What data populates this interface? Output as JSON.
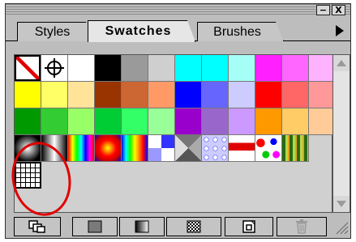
{
  "window": {
    "minimize_label": "−",
    "close_label": "X"
  },
  "tabs": [
    {
      "label": "Styles"
    },
    {
      "label": "Swatches"
    },
    {
      "label": "Brushes"
    }
  ],
  "active_tab": "Swatches",
  "icons": {
    "panel_menu": "triangle-right-icon",
    "scroll_up": "scroll-up-arrow-icon",
    "scroll_down": "scroll-down-arrow-icon",
    "resize": "resize-grip-icon"
  },
  "swatches": {
    "row1": [
      "none",
      "registration",
      "#ffffff",
      "#000000",
      "#9a9a9a",
      "#cfcfcf",
      "#00ffff",
      "#00ffff",
      "#a6fff7",
      "#ff1fff",
      "#ff66ff",
      "#ffb3ff"
    ],
    "row2": [
      "#ffff00",
      "#ffff66",
      "#ffe399",
      "#993300",
      "#cc6633",
      "#ff9966",
      "#0000ff",
      "#6666ff",
      "#ccccff",
      "#ff0000",
      "#ff6666",
      "#ff9999"
    ],
    "row3": [
      "#009900",
      "#33cc33",
      "#99ff66",
      "#00cc33",
      "#33ff66",
      "#99ff99",
      "#9900cc",
      "#9966cc",
      "#cc99ff",
      "#ff9900",
      "#ffcc66",
      "#ffcc99"
    ],
    "row4": [
      "gradient-radial-black",
      "gradient-linear-gray",
      "gradient-rainbow",
      "gradient-radial-red",
      "gradient-spectrum",
      "pattern-blue-tiles",
      "pattern-gray-pyramid",
      "pattern-blue-circles",
      "pattern-red-stripes",
      "pattern-confetti",
      "pattern-green-plants"
    ],
    "row5": [
      "pattern-grid"
    ]
  },
  "bottom_buttons": [
    {
      "icon": "show-all-swatches-icon"
    },
    {
      "icon": "show-color-swatches-icon"
    },
    {
      "icon": "show-gradient-swatches-icon"
    },
    {
      "icon": "show-pattern-swatches-icon"
    },
    {
      "icon": "new-swatch-icon"
    },
    {
      "icon": "delete-swatch-icon"
    }
  ],
  "annotation_color": "#e00000"
}
